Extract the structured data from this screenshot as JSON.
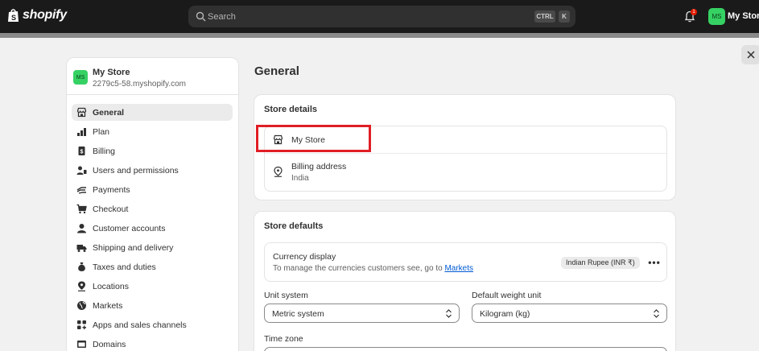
{
  "topbar": {
    "logo_text": "shopify",
    "search_placeholder": "Search",
    "shortcut_ctrl": "CTRL",
    "shortcut_k": "K",
    "notification_count": "1",
    "avatar_initials": "MS",
    "store_name": "My Store"
  },
  "sidebar": {
    "avatar_initials": "MS",
    "store_name": "My Store",
    "store_domain": "2279c5-58.myshopify.com",
    "items": [
      {
        "label": "General",
        "icon": "store-icon",
        "active": true
      },
      {
        "label": "Plan",
        "icon": "plan-chart-icon"
      },
      {
        "label": "Billing",
        "icon": "billing-icon"
      },
      {
        "label": "Users and permissions",
        "icon": "users-icon"
      },
      {
        "label": "Payments",
        "icon": "payments-icon"
      },
      {
        "label": "Checkout",
        "icon": "cart-icon"
      },
      {
        "label": "Customer accounts",
        "icon": "person-icon"
      },
      {
        "label": "Shipping and delivery",
        "icon": "truck-icon"
      },
      {
        "label": "Taxes and duties",
        "icon": "money-bag-icon"
      },
      {
        "label": "Locations",
        "icon": "location-pin-icon"
      },
      {
        "label": "Markets",
        "icon": "globe-icon"
      },
      {
        "label": "Apps and sales channels",
        "icon": "apps-icon"
      },
      {
        "label": "Domains",
        "icon": "domains-icon"
      }
    ]
  },
  "main": {
    "page_title": "General",
    "store_details": {
      "title": "Store details",
      "store_name": "My Store",
      "billing_label": "Billing address",
      "billing_value": "India"
    },
    "store_defaults": {
      "title": "Store defaults",
      "currency_title": "Currency display",
      "currency_desc": "To manage the currencies customers see, go to",
      "currency_link": "Markets",
      "currency_value": "Indian Rupee (INR ₹)",
      "more_label": "•••",
      "unit_label": "Unit system",
      "unit_value": "Metric system",
      "weight_label": "Default weight unit",
      "weight_value": "Kilogram (kg)",
      "timezone_label": "Time zone"
    }
  },
  "colors": {
    "highlight": "#e01e26",
    "link": "#005bd3",
    "avatar": "#36d163",
    "topbar": "#1a1a1a"
  }
}
